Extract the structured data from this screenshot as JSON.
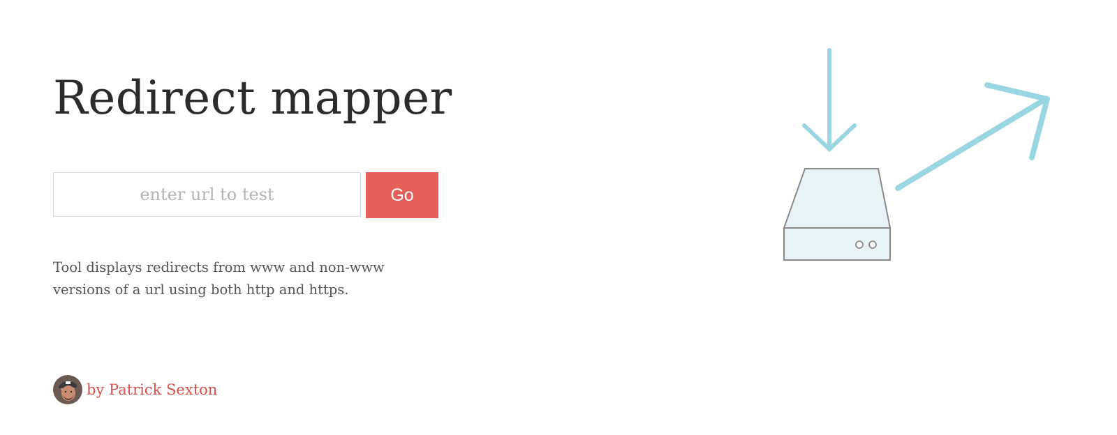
{
  "page": {
    "title": "Redirect mapper",
    "description": "Tool displays redirects from www and non-www versions of a url using both http and https."
  },
  "form": {
    "url_placeholder": "enter url to test",
    "url_value": "",
    "go_label": "Go"
  },
  "byline": {
    "prefix_text": "by ",
    "author": "Patrick Sexton",
    "full_text": "by Patrick Sexton"
  },
  "illustration": {
    "icons": [
      "down-arrow-icon",
      "server-icon",
      "up-right-arrow-icon"
    ],
    "arrow_color": "#99d6e1",
    "server_fill": "#e8f3f7",
    "server_stroke": "#8a8a8a"
  },
  "colors": {
    "accent": "#e35f58",
    "link": "#d8504a",
    "title": "#2b2b2b",
    "body_text": "#555555"
  }
}
